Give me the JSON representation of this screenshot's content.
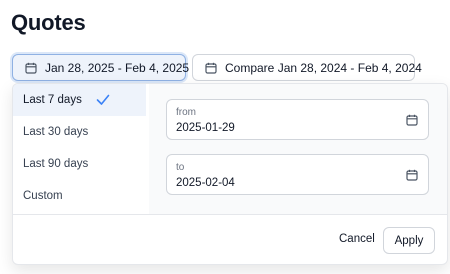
{
  "page": {
    "title": "Quotes"
  },
  "toolbar": {
    "date_range_label": "Jan 28, 2025 - Feb 4, 2025",
    "compare_label": "Compare Jan 28, 2024 - Feb 4, 2024",
    "icon": "calendar-icon"
  },
  "dropdown": {
    "presets": [
      {
        "label": "Last 7 days",
        "selected": true
      },
      {
        "label": "Last 30 days",
        "selected": false
      },
      {
        "label": "Last 90 days",
        "selected": false
      },
      {
        "label": "Custom",
        "selected": false
      }
    ],
    "from": {
      "label": "from",
      "value": "2025-01-29"
    },
    "to": {
      "label": "to",
      "value": "2025-02-04"
    },
    "cancel_label": "Cancel",
    "apply_label": "Apply"
  },
  "colors": {
    "accent": "#3b82f6",
    "selected_bg": "#eef3fb",
    "panel_bg": "#f9fafb"
  }
}
